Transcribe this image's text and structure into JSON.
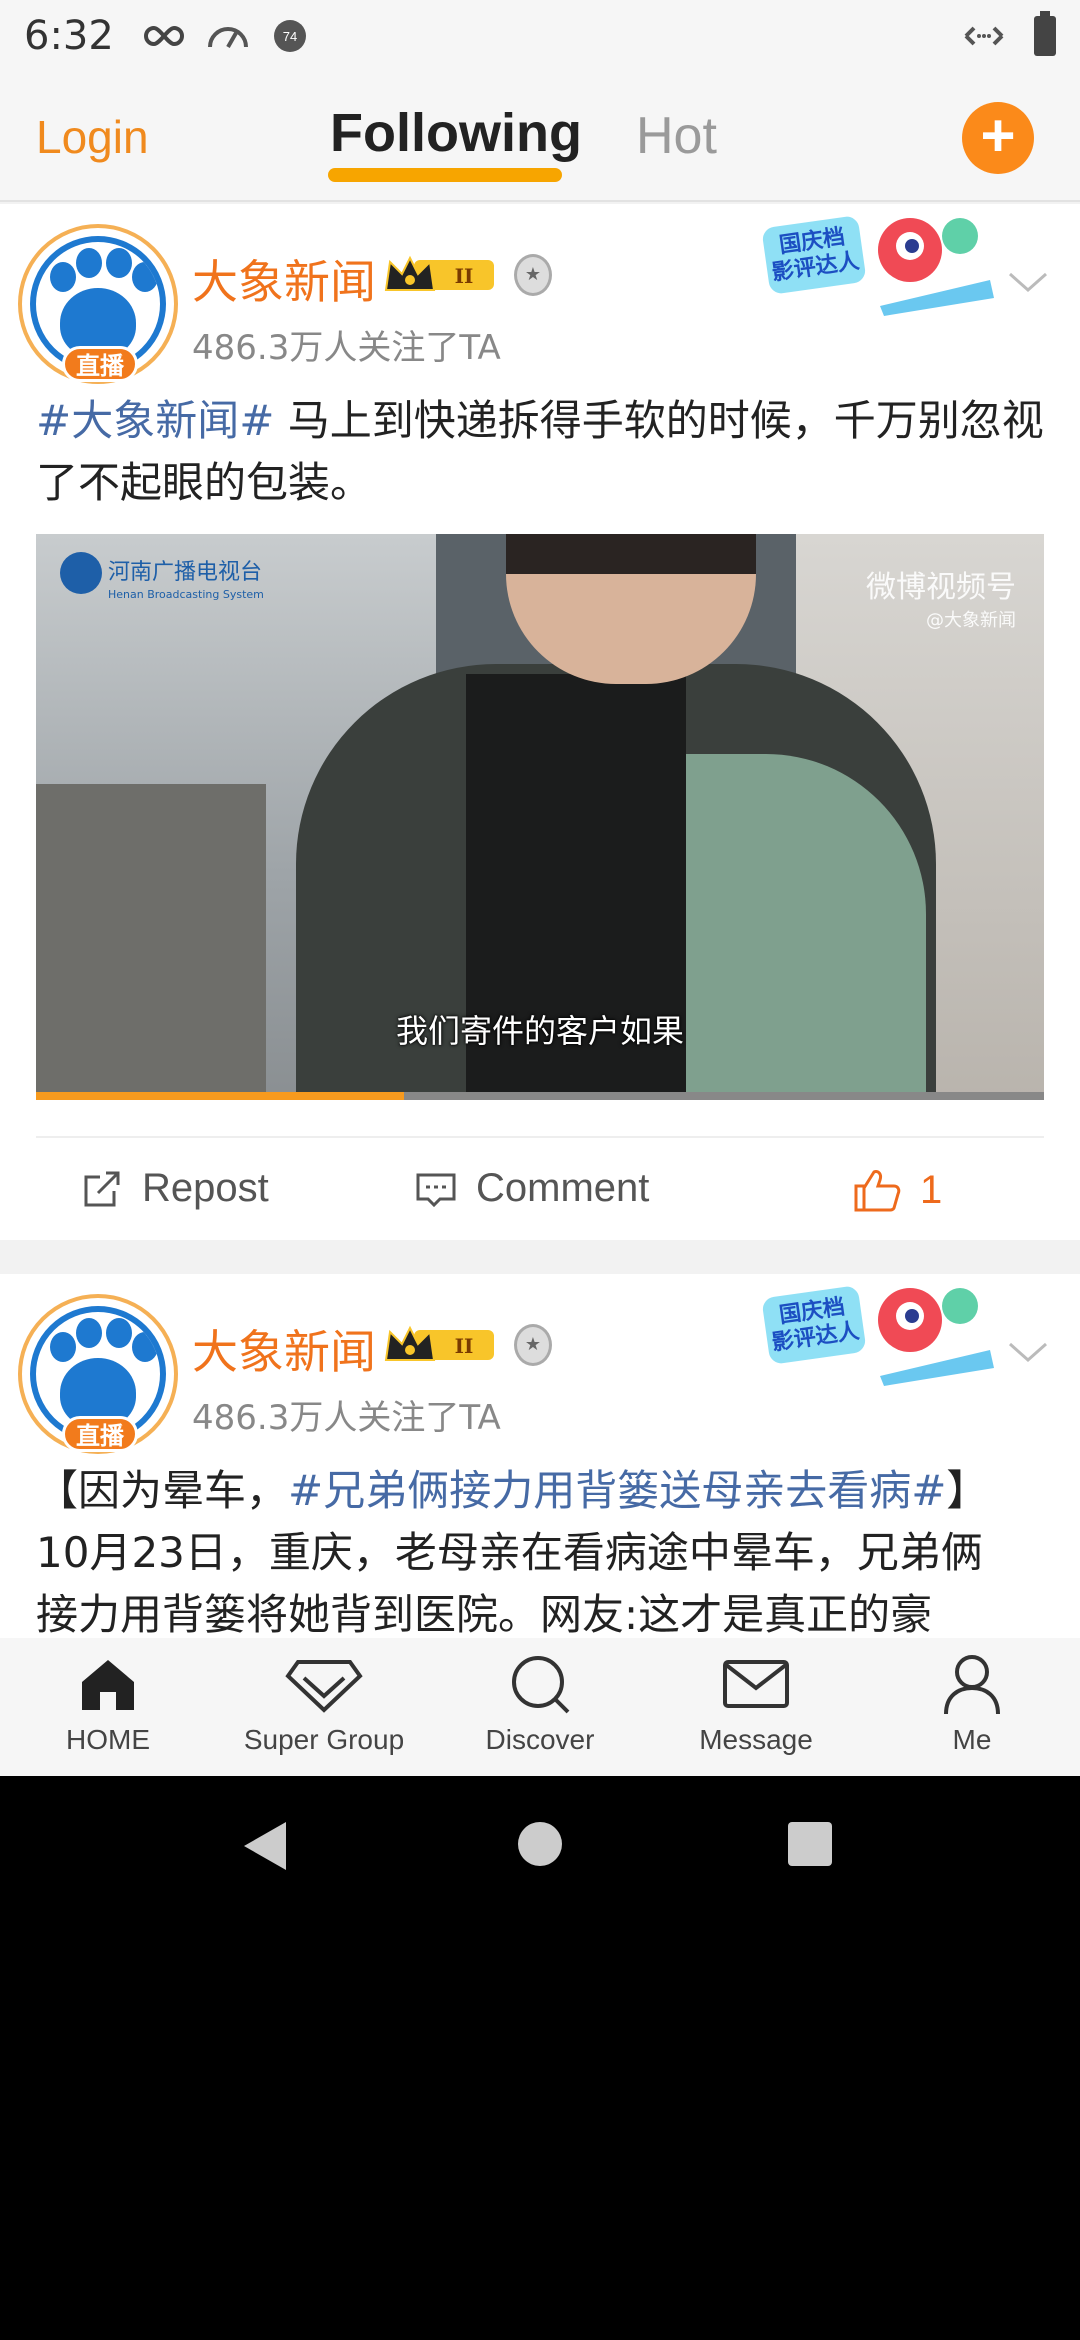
{
  "status_bar": {
    "time": "6:32",
    "indicator_number": "74"
  },
  "top_nav": {
    "login": "Login",
    "tabs": [
      "Following",
      "Hot"
    ],
    "active_tab": "Following",
    "add_icon": "plus-icon",
    "accent_color": "#FB8A1A"
  },
  "posts": [
    {
      "username": "大象新闻",
      "live_label": "直播",
      "followers": "486.3万人关注了TA",
      "badge_level": "II",
      "promo_badge_text": "国庆档影评达人",
      "text_hashtag": "#大象新闻#",
      "text_body": " 马上到快递拆得手软的时候，千万别忽视了不起眼的包装。",
      "video": {
        "broadcaster": "河南广播电视台",
        "broadcaster_en": "Henan Broadcasting System",
        "watermark": "微博视频号",
        "watermark_handle": "@大象新闻",
        "subtitle": "我们寄件的客户如果",
        "progress": 0.365
      },
      "actions": {
        "repost": "Repost",
        "comment": "Comment",
        "likes": "1"
      }
    },
    {
      "username": "大象新闻",
      "live_label": "直播",
      "followers": "486.3万人关注了TA",
      "badge_level": "II",
      "promo_badge_text": "国庆档影评达人",
      "line1_prefix": "【因为晕车，",
      "line1_hashtag": "#兄弟俩接力用背篓送母亲去看病#",
      "line1_suffix": "】",
      "line2": "10月23日，重庆，老母亲在看病途中晕车，兄弟俩",
      "line3": "接力用背篓将她背到医院。网友:这才是真正的豪"
    }
  ],
  "tab_bar": {
    "items": [
      {
        "label": "HOME",
        "icon": "home-icon"
      },
      {
        "label": "Super Group",
        "icon": "diamond-icon"
      },
      {
        "label": "Discover",
        "icon": "search-icon"
      },
      {
        "label": "Message",
        "icon": "mail-icon"
      },
      {
        "label": "Me",
        "icon": "person-icon"
      }
    ]
  }
}
